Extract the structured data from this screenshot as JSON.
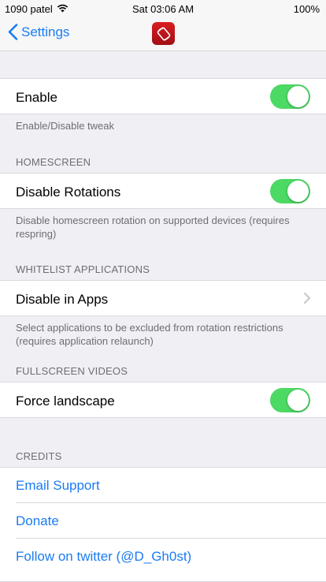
{
  "status": {
    "carrier": "1090 patel",
    "time": "Sat 03:06 AM",
    "battery": "100%"
  },
  "nav": {
    "back_label": "Settings"
  },
  "sections": {
    "enable": {
      "label": "Enable",
      "on": true,
      "footer": "Enable/Disable tweak"
    },
    "homescreen": {
      "header": "HOMESCREEN",
      "label": "Disable Rotations",
      "on": true,
      "footer": "Disable homescreen rotation on supported devices (requires respring)"
    },
    "whitelist": {
      "header": "WHITELIST APPLICATIONS",
      "label": "Disable in Apps",
      "footer": "Select applications to be excluded from rotation restrictions (requires application relaunch)"
    },
    "fullscreen": {
      "header": "FULLSCREEN VIDEOS",
      "label": "Force landscape",
      "on": true
    },
    "credits": {
      "header": "CREDITS",
      "links": [
        "Email Support",
        "Donate",
        "Follow on twitter (@D_Gh0st)"
      ]
    }
  },
  "colors": {
    "accent": "#1a7cf2",
    "toggle_on": "#4cd964",
    "background": "#efeff4"
  }
}
